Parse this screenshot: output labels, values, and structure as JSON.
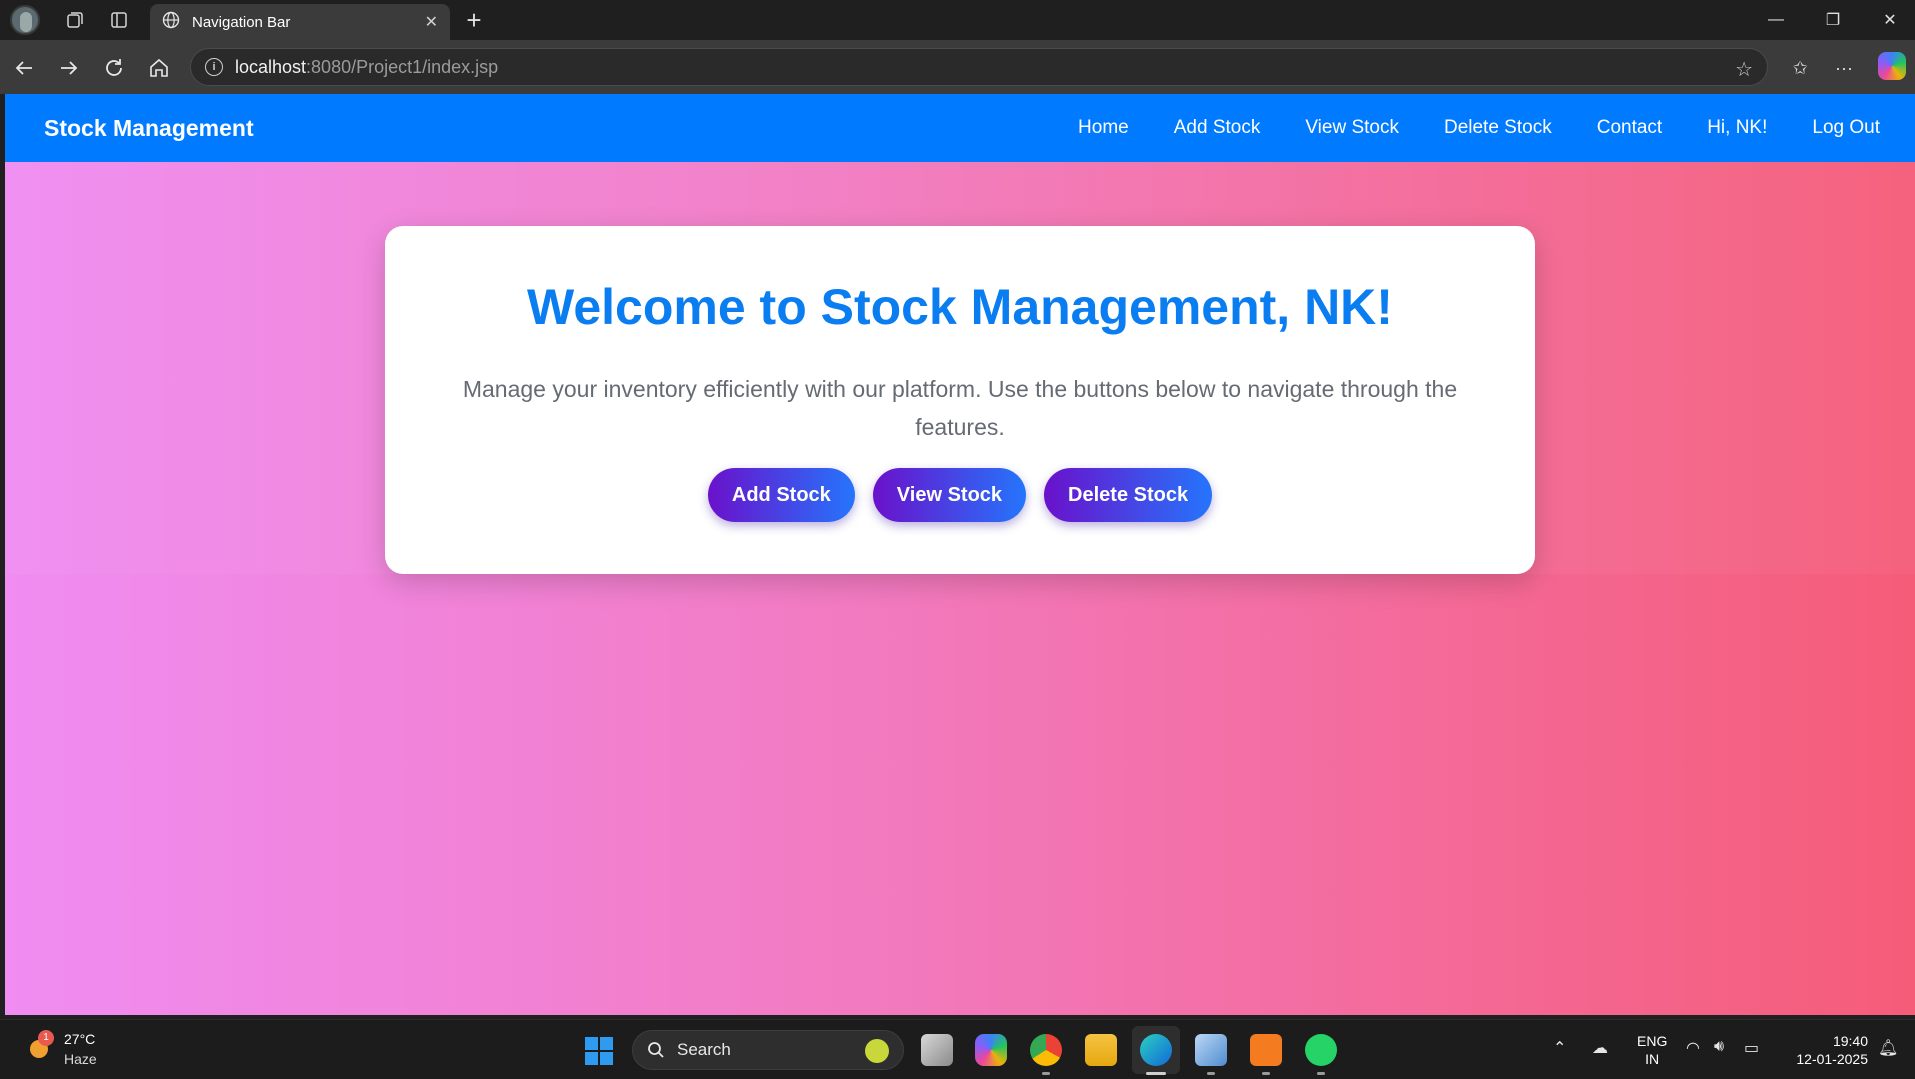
{
  "browser": {
    "tab_title": "Navigation Bar",
    "url_host": "localhost",
    "url_rest": ":8080/Project1/index.jsp"
  },
  "page": {
    "brand": "Stock Management",
    "nav": [
      "Home",
      "Add Stock",
      "View Stock",
      "Delete Stock",
      "Contact",
      "Hi, NK!",
      "Log Out"
    ],
    "title": "Welcome to Stock Management, NK!",
    "description": "Manage your inventory efficiently with our platform. Use the buttons below to navigate through the features.",
    "buttons": [
      "Add Stock",
      "View Stock",
      "Delete Stock"
    ],
    "colors": {
      "navbar": "#007bff",
      "title": "#0a7df0",
      "button_gradient_start": "#6a11cb",
      "button_gradient_end": "#2575fc",
      "bg_gradient_start": "#f08cf2",
      "bg_gradient_end": "#f55c78"
    }
  },
  "taskbar": {
    "temperature": "27°C",
    "weather": "Haze",
    "weather_badge": "1",
    "search_label": "Search",
    "lang_line1": "ENG",
    "lang_line2": "IN",
    "time": "19:40",
    "date": "12-01-2025"
  }
}
